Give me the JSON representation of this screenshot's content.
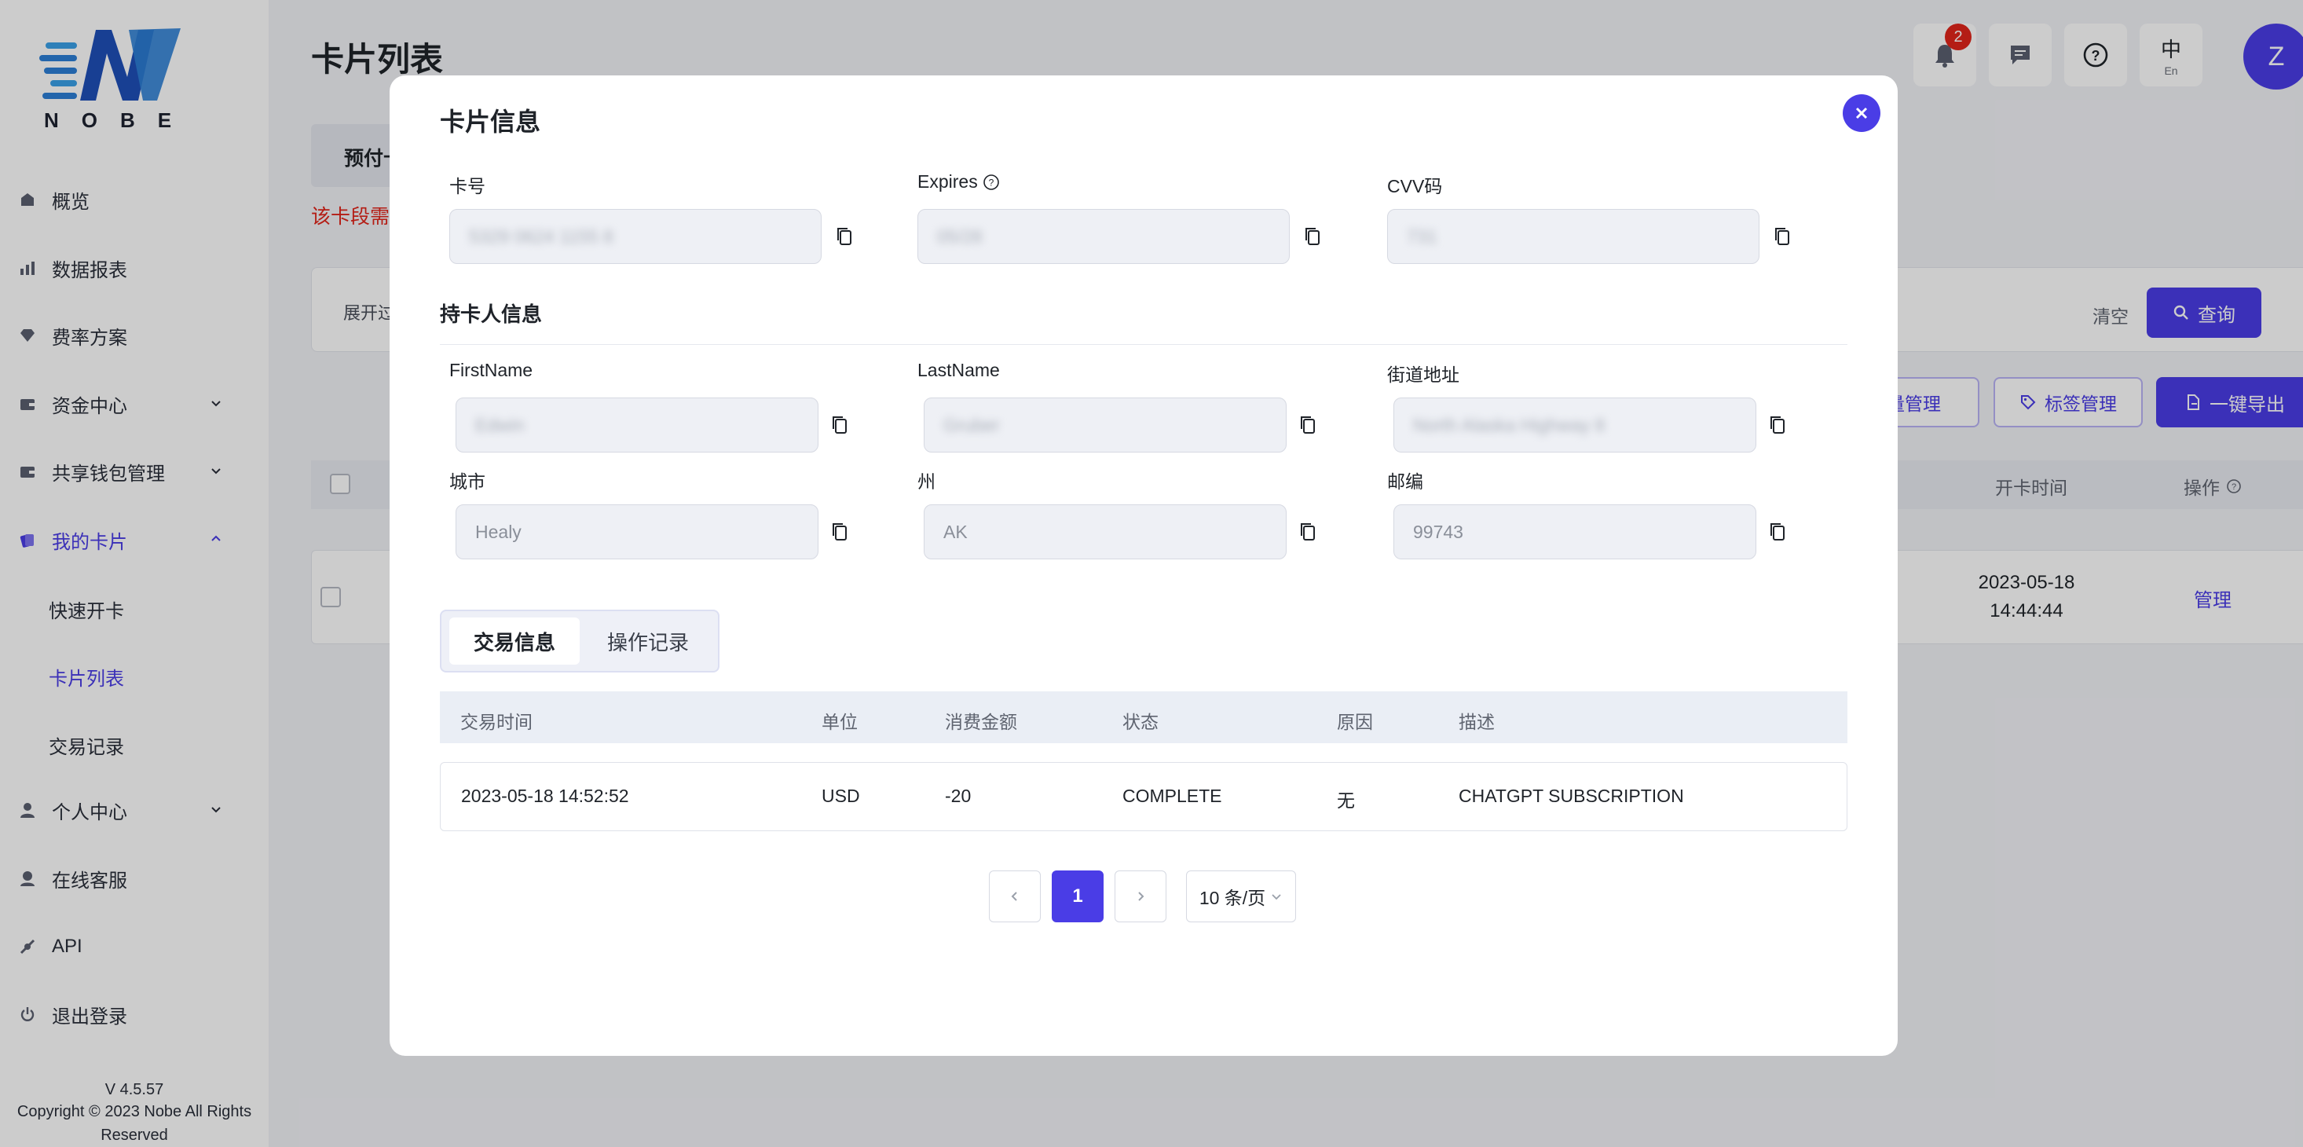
{
  "brand": {
    "logo_text": "NOBE"
  },
  "sidebar": {
    "items": [
      {
        "label": "概览",
        "icon": "dashboard-icon"
      },
      {
        "label": "数据报表",
        "icon": "chart-icon"
      },
      {
        "label": "费率方案",
        "icon": "diamond-icon"
      },
      {
        "label": "资金中心",
        "icon": "wallet-icon"
      },
      {
        "label": "共享钱包管理",
        "icon": "wallet-icon"
      },
      {
        "label": "我的卡片",
        "icon": "cards-icon"
      },
      {
        "label": "个人中心",
        "icon": "user-icon"
      },
      {
        "label": "在线客服",
        "icon": "support-icon"
      },
      {
        "label": "API",
        "icon": "api-icon"
      },
      {
        "label": "退出登录",
        "icon": "power-icon"
      }
    ],
    "sub_items": [
      {
        "label": "快速开卡"
      },
      {
        "label": "卡片列表"
      },
      {
        "label": "交易记录"
      }
    ],
    "version": "V 4.5.57",
    "copyright": "Copyright © 2023 Nobe All Rights Reserved"
  },
  "page": {
    "title": "卡片列表",
    "tab_label": "预付卡",
    "warning": "该卡段需",
    "filter_expand": "展开过",
    "clear_label": "清空",
    "query_label": "查询",
    "batch_label": "批量管理",
    "tag_label": "标签管理",
    "export_label": "一键导出",
    "col_open_time": "开卡时间",
    "col_action": "操作",
    "row_date": "2023-05-18",
    "row_time": "14:44:44",
    "row_manage": "管理"
  },
  "topbar": {
    "notification_count": "2",
    "lang_zh": "中",
    "lang_en": "En",
    "avatar_letter": "Z"
  },
  "modal": {
    "title": "卡片信息",
    "card_fields": [
      {
        "label": "卡号",
        "value": "5329 0624 1155 8"
      },
      {
        "label": "Expires",
        "value": "05/28"
      },
      {
        "label": "CVV码",
        "value": "731"
      }
    ],
    "holder_title": "持卡人信息",
    "holder_fields": [
      {
        "label": "FirstName",
        "value": "Edwin"
      },
      {
        "label": "LastName",
        "value": "Gruber"
      },
      {
        "label": "街道地址",
        "value": "North Alaska Highway 8"
      },
      {
        "label": "城市",
        "value": "Healy"
      },
      {
        "label": "州",
        "value": "AK"
      },
      {
        "label": "邮编",
        "value": "99743"
      }
    ],
    "tabs": [
      {
        "label": "交易信息",
        "active": true
      },
      {
        "label": "操作记录",
        "active": false
      }
    ],
    "tx_columns": [
      "交易时间",
      "单位",
      "消费金额",
      "状态",
      "原因",
      "描述"
    ],
    "tx_rows": [
      [
        "2023-05-18 14:52:52",
        "USD",
        "-20",
        "COMPLETE",
        "无",
        "CHATGPT SUBSCRIPTION"
      ]
    ],
    "pagination": {
      "current_page": "1",
      "page_size": "10 条/页"
    }
  },
  "colors": {
    "accent": "#4a3de6",
    "danger": "#e1251b"
  }
}
